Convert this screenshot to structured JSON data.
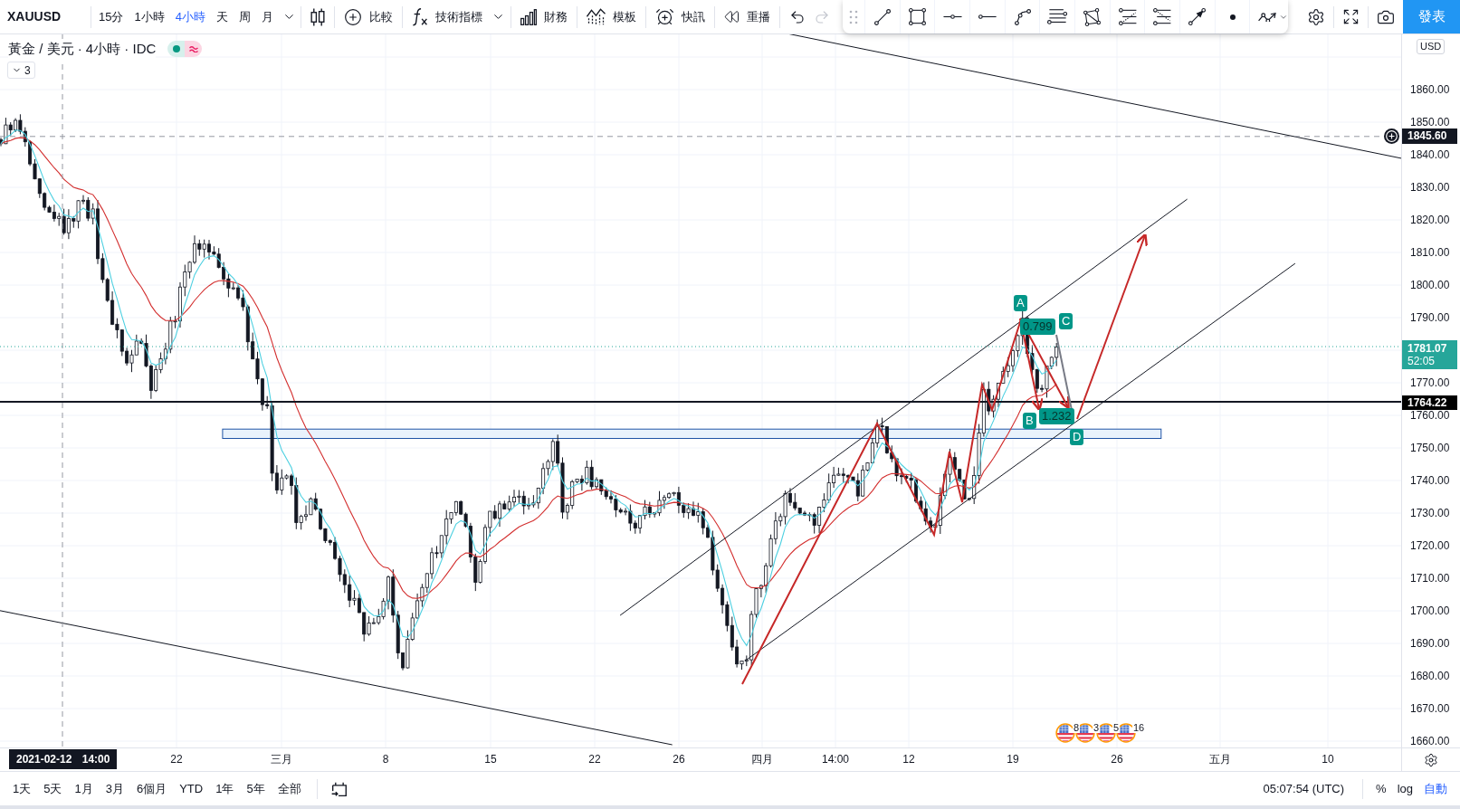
{
  "toolbar": {
    "symbol": "XAUUSD",
    "intervals": [
      {
        "label": "15分",
        "selected": false
      },
      {
        "label": "1小時",
        "selected": false
      },
      {
        "label": "4小時",
        "selected": true
      },
      {
        "label": "天",
        "selected": false
      },
      {
        "label": "周",
        "selected": false
      },
      {
        "label": "月",
        "selected": false
      }
    ],
    "buttons": [
      {
        "kind": "compare",
        "label": "比較"
      },
      {
        "kind": "indicators",
        "label": "技術指標"
      },
      {
        "kind": "financials",
        "label": "財務"
      },
      {
        "kind": "templates",
        "label": "模板"
      },
      {
        "kind": "alert",
        "label": "快訊"
      },
      {
        "kind": "replay",
        "label": "重播"
      }
    ],
    "history_buttons": [
      {
        "kind": "undo",
        "disabled": false
      },
      {
        "kind": "redo",
        "disabled": true
      }
    ],
    "publish_button": "發表"
  },
  "legend": {
    "title": "黃金 / 美元 · 4小時 · IDC",
    "hidden_indicator_count": "3"
  },
  "harmonic_pattern_labels": [
    {
      "kind": "point",
      "text": "A"
    },
    {
      "kind": "ratio",
      "text": "0.799"
    },
    {
      "kind": "point",
      "text": "C"
    },
    {
      "kind": "point",
      "text": "B"
    },
    {
      "kind": "ratio",
      "text": "1.232"
    },
    {
      "kind": "point",
      "text": "D"
    }
  ],
  "economic_events": [
    {
      "count": "8"
    },
    {
      "count": "3"
    },
    {
      "count": "5"
    },
    {
      "count": "16"
    }
  ],
  "price_axis": {
    "currency": "USD",
    "labels_upper": [
      "1860.00",
      "1850.00",
      "1840.00",
      "1830.00",
      "1820.00",
      "1810.00",
      "1800.00",
      "1790.00"
    ],
    "labels_lower": [
      "1770.00",
      "1760.00",
      "1750.00",
      "1740.00",
      "1730.00",
      "1720.00",
      "1710.00",
      "1700.00",
      "1690.00",
      "1680.00",
      "1670.00",
      "1660.00"
    ],
    "crosshair_price": "1845.60",
    "last_price": "1781.07",
    "countdown": "52:05",
    "line_price": "1764.22"
  },
  "time_axis": {
    "crosshair_label": "2021-02-12 14:00",
    "labels": [
      "22",
      "三月",
      "8",
      "15",
      "22",
      "26",
      "四月",
      "14:00",
      "12",
      "19",
      "26",
      "五月",
      "10"
    ]
  },
  "range_bar": {
    "ranges": [
      "1天",
      "5天",
      "1月",
      "3月",
      "6個月",
      "YTD",
      "1年",
      "5年",
      "全部"
    ],
    "clock": "05:07:54 (UTC)",
    "scale_modes": [
      {
        "label": "%",
        "selected": false
      },
      {
        "label": "log",
        "selected": false
      },
      {
        "label": "自動",
        "selected": true
      }
    ]
  }
}
